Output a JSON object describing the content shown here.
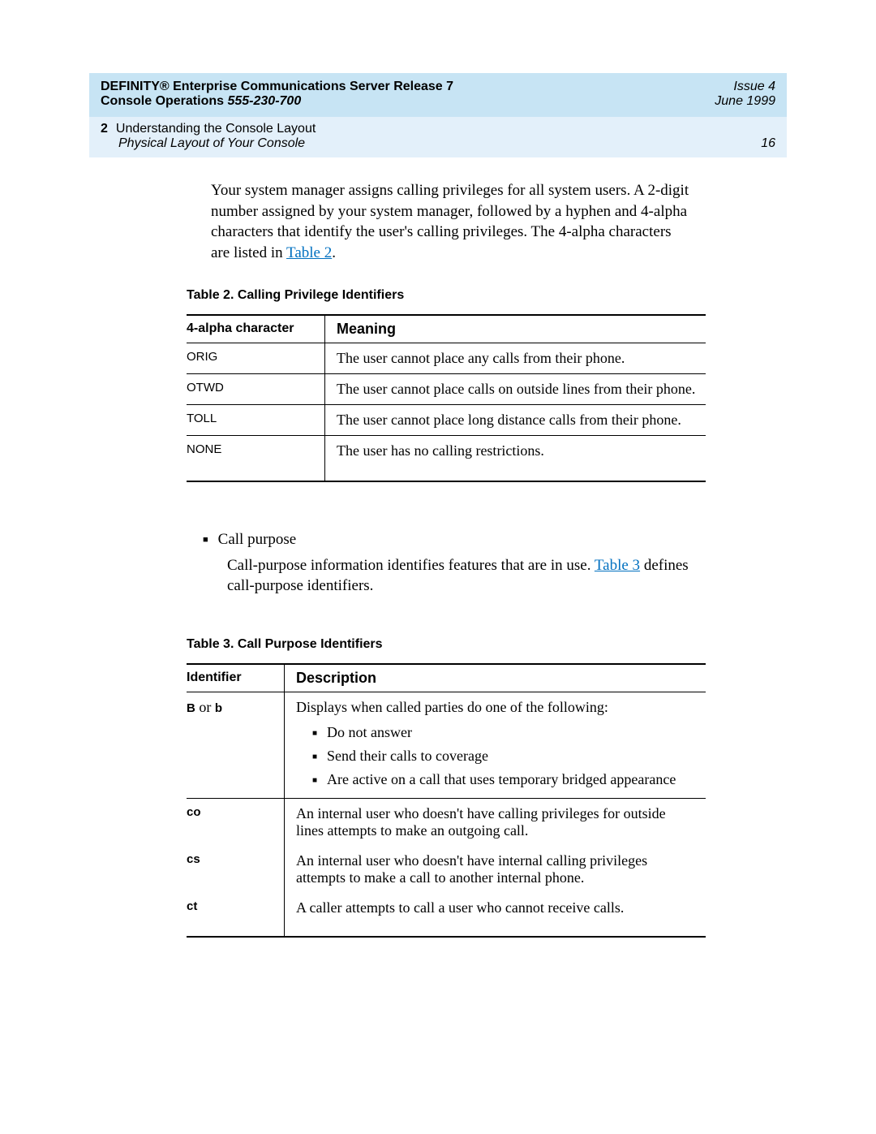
{
  "header": {
    "title_line1": "DEFINITY® Enterprise Communications Server Release 7",
    "title_line2_a": "Console Operations  ",
    "title_line2_b": "555-230-700",
    "issue": "Issue 4",
    "date": "June 1999",
    "chapter_number": "2",
    "chapter_title": "Understanding the Console Layout",
    "chapter_subtitle": "Physical Layout of Your Console",
    "page_number": "16"
  },
  "intro_paragraph": "Your system manager assigns calling privileges for all system users. A 2-digit number assigned by your system manager, followed by a hyphen and 4-alpha characters that identify the user's calling privileges. The 4-alpha characters are listed in ",
  "intro_link": "Table 2",
  "intro_period": ".",
  "table2": {
    "caption": "Table 2.    Calling Privilege Identifiers",
    "headers": [
      "4-alpha character",
      "Meaning"
    ],
    "rows": [
      {
        "c1": "ORIG",
        "c2": "The user cannot place any calls from their phone."
      },
      {
        "c1": "OTWD",
        "c2": "The user cannot place calls on outside lines from their phone."
      },
      {
        "c1": "TOLL",
        "c2": "The user cannot place long distance calls from their phone."
      },
      {
        "c1": "NONE",
        "c2": "The user has no calling restrictions."
      }
    ]
  },
  "call_purpose": {
    "heading": "Call purpose",
    "body_a": "Call-purpose information identifies features that are in use. ",
    "body_link": "Table 3",
    "body_b": " defines call-purpose identifiers."
  },
  "table3": {
    "caption": "Table 3.    Call Purpose Identifiers",
    "headers": [
      "Identifier",
      "Description"
    ],
    "rows": [
      {
        "c1_a": "B",
        "c1_mid": " or ",
        "c1_b": "b",
        "c2_intro": "Displays when called parties do one of the following:",
        "items": [
          "Do not answer",
          "Send their calls to coverage",
          "Are active on a call that uses temporary bridged appearance"
        ]
      },
      {
        "c1": "co",
        "c2": "An internal user who doesn't have calling privileges for outside lines attempts to make an outgoing call."
      },
      {
        "c1": "cs",
        "c2": "An internal user who doesn't have internal calling privileges attempts to make a call to another internal phone."
      },
      {
        "c1": "ct",
        "c2": "A caller attempts to call a user who cannot receive calls."
      }
    ]
  }
}
